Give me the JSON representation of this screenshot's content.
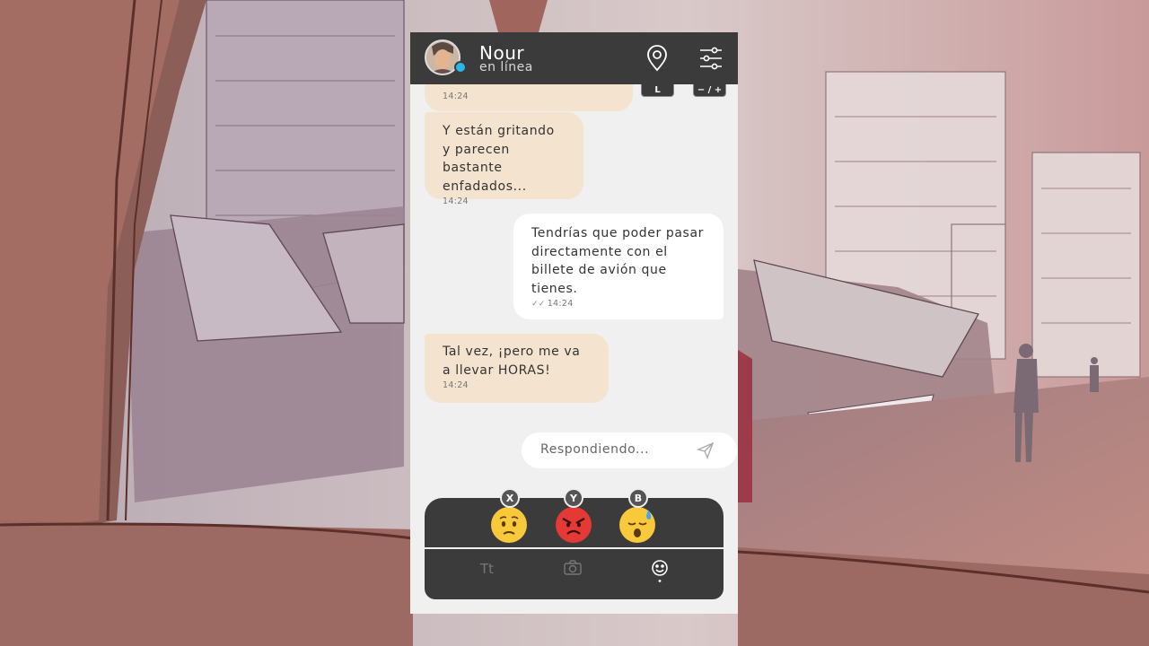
{
  "header": {
    "contact_name": "Nour",
    "status": "en línea",
    "location_icon": "location-pin-icon",
    "settings_icon": "sliders-icon",
    "key_location": "L",
    "key_zoom": "− / +"
  },
  "messages": [
    {
      "direction": "in",
      "text": "",
      "time": "14:24"
    },
    {
      "direction": "in",
      "text": "Y están gritando y parecen bastante enfadados...",
      "time": "14:24"
    },
    {
      "direction": "out",
      "text": "Tendrías que poder pasar directamente con el billete de avión que tienes.",
      "time": "14:24",
      "read_ticks": "✓✓"
    },
    {
      "direction": "in",
      "text": "Tal vez, ¡pero me va a llevar HORAS!",
      "time": "14:24"
    }
  ],
  "reply": {
    "placeholder": "Respondiendo..."
  },
  "reactions": [
    {
      "button": "X",
      "emoji": "worried-face"
    },
    {
      "button": "Y",
      "emoji": "angry-face"
    },
    {
      "button": "B",
      "emoji": "anxious-sweat-face"
    }
  ],
  "toolbar": {
    "text_tool": "Tt",
    "camera_icon": "camera-icon",
    "emoji_icon": "smiley-icon"
  },
  "colors": {
    "header_bg": "#3b3b3b",
    "incoming_bubble": "#f4e4cf",
    "outgoing_bubble": "#ffffff",
    "online_dot": "#29b6e8"
  }
}
